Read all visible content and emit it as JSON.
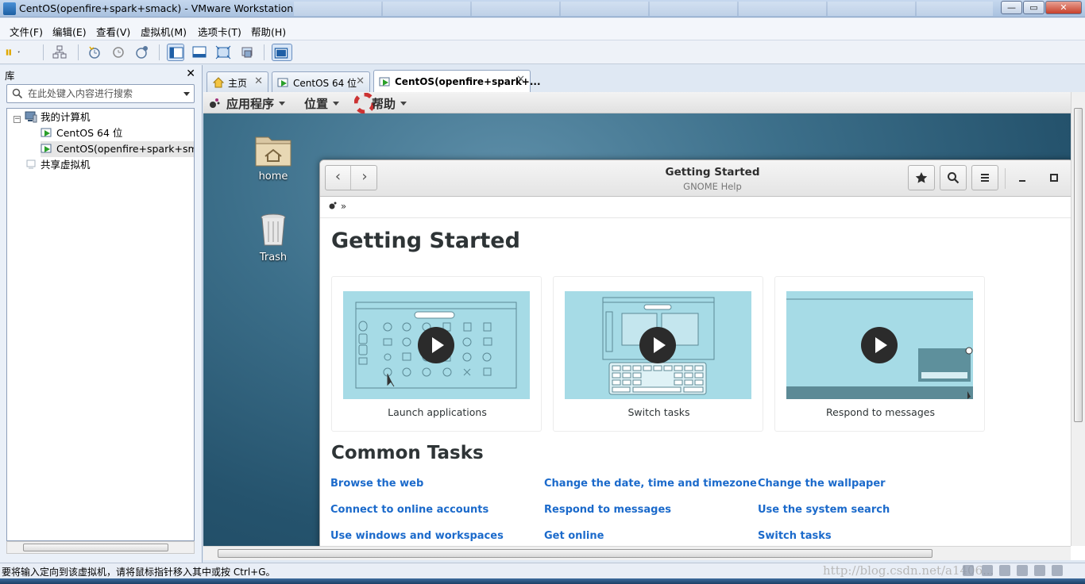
{
  "window": {
    "title": "CentOS(openfire+spark+smack) - VMware Workstation"
  },
  "menu": [
    "文件(F)",
    "编辑(E)",
    "查看(V)",
    "虚拟机(M)",
    "选项卡(T)",
    "帮助(H)"
  ],
  "library": {
    "title": "库",
    "search_placeholder": "在此处键入内容进行搜索",
    "tree": {
      "root": "我的计算机",
      "vm1": "CentOS 64 位",
      "vm2": "CentOS(openfire+spark+sma",
      "shared": "共享虚拟机"
    }
  },
  "tabs": {
    "home": "主页",
    "centos64": "CentOS 64 位",
    "active": "CentOS(openfire+spark+..."
  },
  "gnome_menu": {
    "apps": "应用程序",
    "places": "位置",
    "help": "帮助"
  },
  "desktop": {
    "home": "home",
    "trash": "Trash"
  },
  "help": {
    "title": "Getting Started",
    "subtitle": "GNOME Help",
    "crumb_sep": "»",
    "heading": "Getting Started",
    "videos": [
      "Launch applications",
      "Switch tasks",
      "Respond to messages"
    ],
    "common_title": "Common Tasks",
    "tasks": [
      [
        "Browse the web",
        "Change the date, time and timezone",
        "Change the wallpaper"
      ],
      [
        "Connect to online accounts",
        "Respond to messages",
        "Use the system search"
      ],
      [
        "Use windows and workspaces",
        "Get online",
        "Switch tasks"
      ]
    ]
  },
  "status": {
    "text": "要将输入定向到该虚拟机，请将鼠标指针移入其中或按 Ctrl+G。",
    "watermark": "http://blog.csdn.net/a1406..."
  },
  "colors": {
    "link": "#1b6acb",
    "desktop": "#3c6f8a",
    "thumb": "#a6dbe6"
  }
}
